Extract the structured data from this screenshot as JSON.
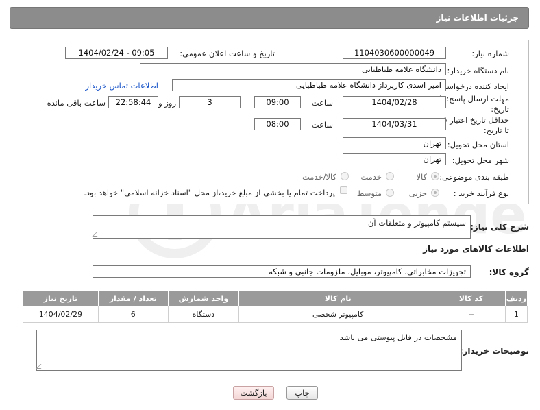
{
  "header": {
    "title": "جزئیات اطلاعات نیاز"
  },
  "form": {
    "need_number_label": "شماره نیاز:",
    "need_number": "1104030600000049",
    "announce_label": "تاریخ و ساعت اعلان عمومی:",
    "announce_value": "1404/02/24 - 09:05",
    "buyer_org_label": "نام دستگاه خریدار:",
    "buyer_org": "دانشگاه علامه طباطبایی",
    "creator_label": "ایجاد کننده درخواست:",
    "creator": "امیر اسدی کارپرداز دانشگاه علامه طباطبایی",
    "contact_link": "اطلاعات تماس خریدار",
    "deadline_label_1": "مهلت ارسال پاسخ: تا",
    "deadline_label_2": "تاریخ:",
    "deadline_date": "1404/02/28",
    "time_label": "ساعت",
    "deadline_time": "09:00",
    "days_value": "3",
    "days_label": "روز و",
    "remaining_time": "22:58:44",
    "remaining_label": "ساعت باقی مانده",
    "price_validity_label_1": "حداقل تاریخ اعتبار قیمت:",
    "price_validity_label_2": "تا تاریخ:",
    "price_validity_date": "1404/03/31",
    "price_validity_time": "08:00",
    "province_label": "استان محل تحویل:",
    "province": "تهران",
    "city_label": "شهر محل تحویل:",
    "city": "تهران",
    "category_label": "طبقه بندی موضوعی:",
    "category_options": [
      "کالا",
      "خدمت",
      "کالا/خدمت"
    ],
    "process_label": "نوع فرآیند خرید :",
    "process_options": [
      "جزیی",
      "متوسط"
    ],
    "payment_note": "پرداخت تمام یا بخشی از مبلغ خرید،از محل \"اسناد خزانه اسلامی\" خواهد بود."
  },
  "description": {
    "label": "شرح کلی نیاز:",
    "value": "سیستم کامپیوتر و متعلقات آن"
  },
  "goods_section": {
    "title": "اطلاعات کالاهای مورد نیاز",
    "group_label": "گروه کالا:",
    "group_value": "تجهیزات مخابراتی، کامپیوتر، موبایل، ملزومات جانبی و شبکه"
  },
  "table": {
    "headers": [
      "ردیف",
      "کد کالا",
      "نام کالا",
      "واحد شمارش",
      "تعداد / مقدار",
      "تاریخ نیاز"
    ],
    "rows": [
      [
        "1",
        "--",
        "کامپیوتر شخصی",
        "دستگاه",
        "6",
        "1404/02/29"
      ]
    ]
  },
  "buyer_notes": {
    "label": "توضیحات خریدار:",
    "value": "مشخصات در فایل پیوستی می باشد"
  },
  "buttons": {
    "print": "چاپ",
    "back": "بازگشت"
  },
  "colors": {
    "header": "#8c8c8c",
    "link": "#1a55c8",
    "back_button": "#f4d6d6"
  }
}
